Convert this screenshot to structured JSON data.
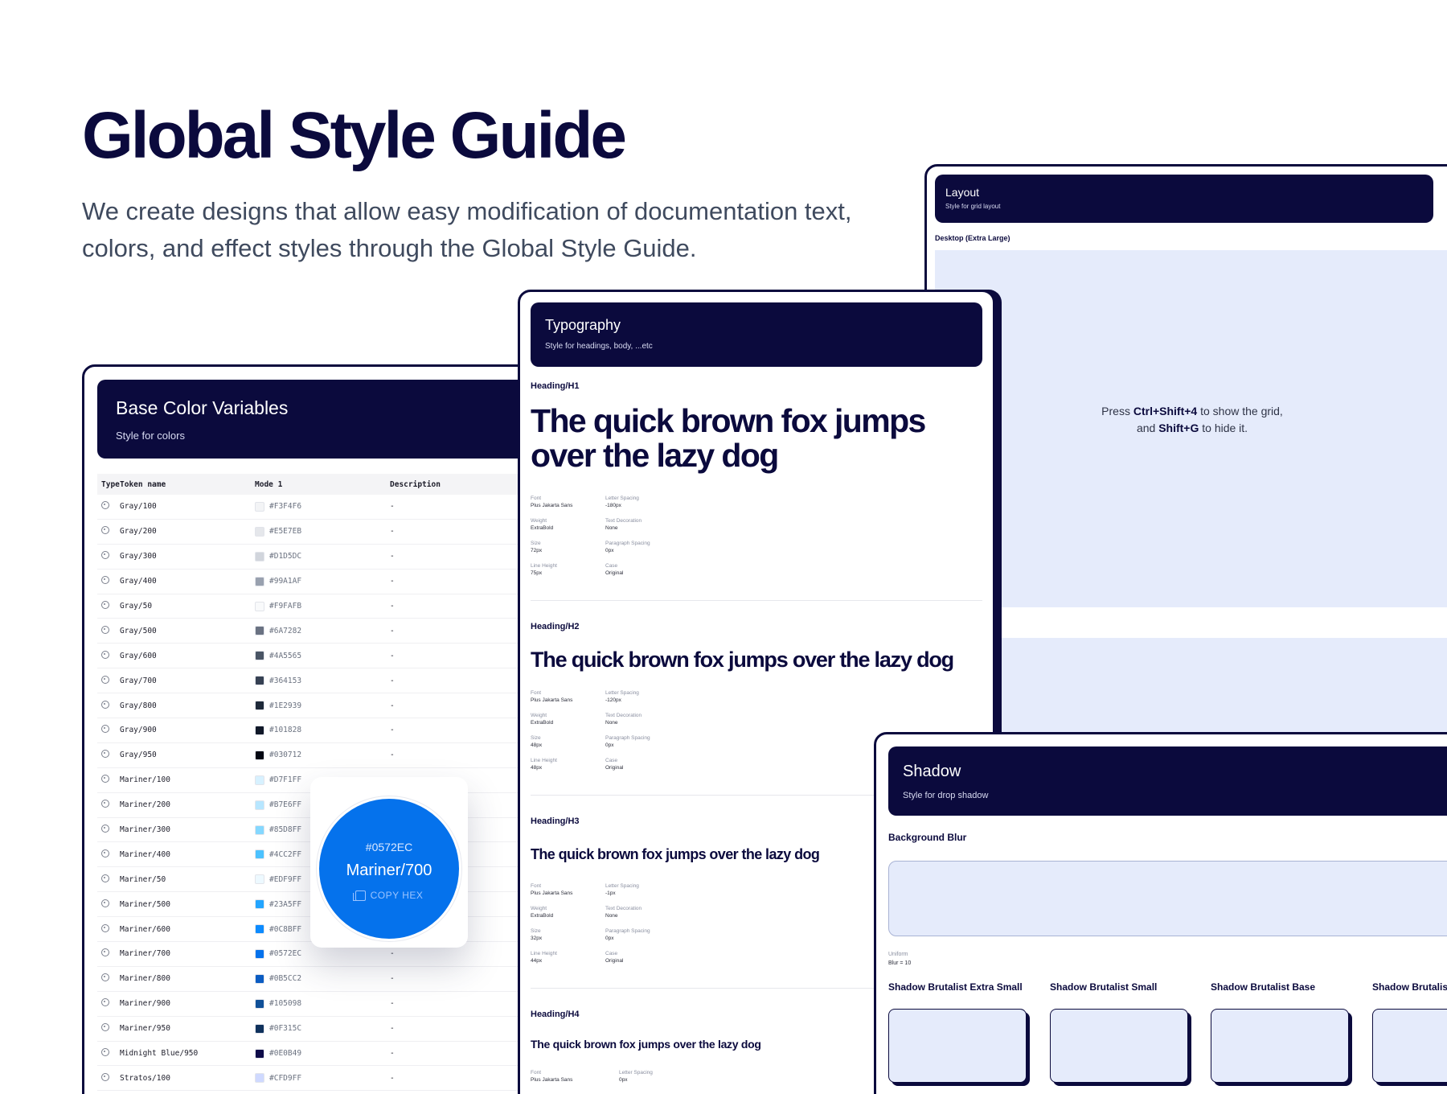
{
  "hero": {
    "title": "Global Style Guide",
    "subtitle": "We create designs that allow easy modification of documentation text, colors, and effect styles through the Global Style Guide."
  },
  "colors_panel": {
    "title": "Base Color Variables",
    "subtitle": "Style for colors",
    "headers": {
      "type": "Type",
      "token": "Token name",
      "mode": "Mode 1",
      "desc": "Description"
    },
    "rows": [
      {
        "name": "Gray/100",
        "hex": "#F3F4F6",
        "desc": "-"
      },
      {
        "name": "Gray/200",
        "hex": "#E5E7EB",
        "desc": "-"
      },
      {
        "name": "Gray/300",
        "hex": "#D1D5DC",
        "desc": "-"
      },
      {
        "name": "Gray/400",
        "hex": "#99A1AF",
        "desc": "-"
      },
      {
        "name": "Gray/50",
        "hex": "#F9FAFB",
        "desc": "-"
      },
      {
        "name": "Gray/500",
        "hex": "#6A7282",
        "desc": "-"
      },
      {
        "name": "Gray/600",
        "hex": "#4A5565",
        "desc": "-"
      },
      {
        "name": "Gray/700",
        "hex": "#364153",
        "desc": "-"
      },
      {
        "name": "Gray/800",
        "hex": "#1E2939",
        "desc": "-"
      },
      {
        "name": "Gray/900",
        "hex": "#101828",
        "desc": "-"
      },
      {
        "name": "Gray/950",
        "hex": "#030712",
        "desc": "-"
      },
      {
        "name": "Mariner/100",
        "hex": "#D7F1FF",
        "desc": "-"
      },
      {
        "name": "Mariner/200",
        "hex": "#B7E6FF",
        "desc": "-"
      },
      {
        "name": "Mariner/300",
        "hex": "#85D8FF",
        "desc": "-"
      },
      {
        "name": "Mariner/400",
        "hex": "#4CC2FF",
        "desc": "-"
      },
      {
        "name": "Mariner/50",
        "hex": "#EDF9FF",
        "desc": "-"
      },
      {
        "name": "Mariner/500",
        "hex": "#23A5FF",
        "desc": "-"
      },
      {
        "name": "Mariner/600",
        "hex": "#0C8BFF",
        "desc": "-"
      },
      {
        "name": "Mariner/700",
        "hex": "#0572EC",
        "desc": "-"
      },
      {
        "name": "Mariner/800",
        "hex": "#0B5CC2",
        "desc": "-"
      },
      {
        "name": "Mariner/900",
        "hex": "#105098",
        "desc": "-"
      },
      {
        "name": "Mariner/950",
        "hex": "#0F315C",
        "desc": "-"
      },
      {
        "name": "Midnight Blue/950",
        "hex": "#0E0B49",
        "desc": "-"
      },
      {
        "name": "Stratos/100",
        "hex": "#CFD9FF",
        "desc": "-"
      }
    ]
  },
  "color_popover": {
    "hex": "#0572EC",
    "name": "Mariner/700",
    "copy_label": "COPY HEX"
  },
  "layout_panel": {
    "title": "Layout",
    "subtitle": "Style for grid layout",
    "section_label": "Desktop (Extra Large)",
    "hint_1": "Press ",
    "hint_key_1": "Ctrl+Shift+4",
    "hint_2": " to show the grid, and ",
    "hint_key_2": "Shift+G",
    "hint_3": " to hide it."
  },
  "typography_panel": {
    "title": "Typography",
    "subtitle": "Style for headings, body, ...etc",
    "sample_text": "The quick brown fox jumps over the lazy dog",
    "meta_labels": {
      "font": "Font",
      "weight": "Weight",
      "size": "Size",
      "line_height": "Line Height",
      "letter_spacing": "Letter Spacing",
      "text_decoration": "Text Decoration",
      "paragraph_spacing": "Paragraph Spacing",
      "case": "Case"
    },
    "headings": [
      {
        "label": "Heading/H1",
        "font": "Plus Jakarta Sans",
        "weight": "ExtraBold",
        "size": "72px",
        "line_height": "75px",
        "letter_spacing": "-180px",
        "text_decoration": "None",
        "paragraph_spacing": "0px",
        "case": "Original"
      },
      {
        "label": "Heading/H2",
        "font": "Plus Jakarta Sans",
        "weight": "ExtraBold",
        "size": "48px",
        "line_height": "48px",
        "letter_spacing": "-120px",
        "text_decoration": "None",
        "paragraph_spacing": "0px",
        "case": "Original"
      },
      {
        "label": "Heading/H3",
        "font": "Plus Jakarta Sans",
        "weight": "ExtraBold",
        "size": "32px",
        "line_height": "44px",
        "letter_spacing": "-1px",
        "text_decoration": "None",
        "paragraph_spacing": "0px",
        "case": "Original"
      },
      {
        "label": "Heading/H4",
        "font": "Plus Jakarta Sans",
        "letter_spacing": "0px"
      }
    ]
  },
  "shadow_panel": {
    "title": "Shadow",
    "subtitle": "Style for drop shadow",
    "blur_label": "Background Blur",
    "blur_meta_1": "Uniform",
    "blur_meta_2": "Blur = 10",
    "shadows": [
      "Shadow Brutalist Extra Small",
      "Shadow Brutalist Small",
      "Shadow Brutalist Base",
      "Shadow Brutalist"
    ]
  },
  "colors": {
    "navy": "#0B0A3D",
    "grid_fill": "#E5EBFB",
    "accent": "#0572EC"
  }
}
